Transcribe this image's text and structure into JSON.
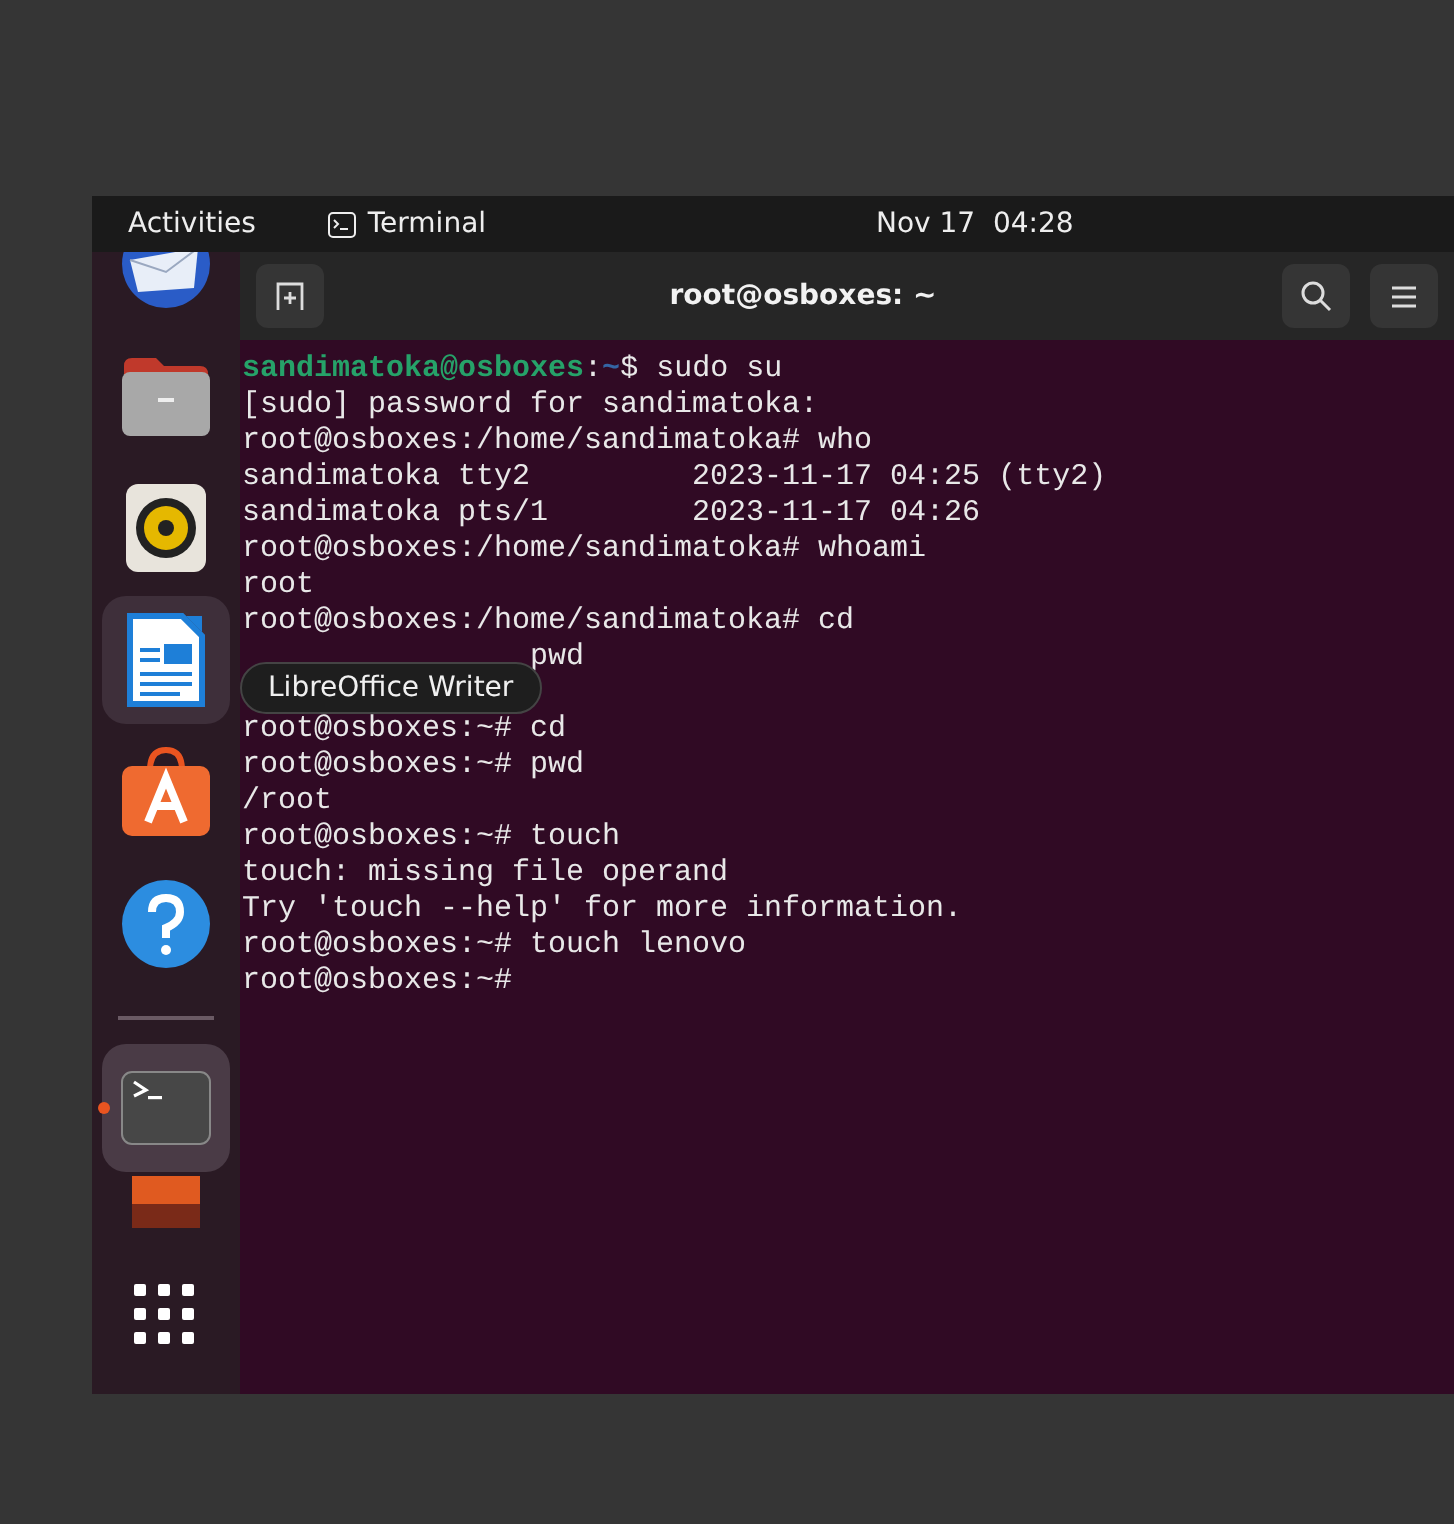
{
  "top_bar": {
    "activities": "Activities",
    "app_menu": "Terminal",
    "clock": "Nov 17  04:28"
  },
  "dock": {
    "items": [
      {
        "kind": "mail",
        "hovered": false,
        "running": false
      },
      {
        "kind": "files",
        "hovered": false,
        "running": false
      },
      {
        "kind": "music",
        "hovered": false,
        "running": false
      },
      {
        "kind": "writer",
        "hovered": true,
        "running": false
      },
      {
        "kind": "store",
        "hovered": false,
        "running": false
      },
      {
        "kind": "help",
        "hovered": false,
        "running": false
      },
      {
        "kind": "terminal",
        "hovered": false,
        "running": true
      },
      {
        "kind": "image",
        "hovered": false,
        "running": false
      },
      {
        "kind": "apps",
        "hovered": false,
        "running": false
      }
    ],
    "tooltip": "LibreOffice Writer"
  },
  "terminal": {
    "title": "root@osboxes: ~",
    "lines": [
      {
        "kind": "text",
        "segments": [
          {
            "kind": "user",
            "text": "sandimatoka@osboxes"
          },
          {
            "kind": "plain",
            "text": ":"
          },
          {
            "kind": "path",
            "text": "~"
          },
          {
            "kind": "plain",
            "text": "$ sudo su"
          }
        ]
      },
      {
        "kind": "text",
        "segments": [
          {
            "kind": "plain",
            "text": "[sudo] password for sandimatoka:"
          }
        ]
      },
      {
        "kind": "text",
        "segments": [
          {
            "kind": "plain",
            "text": "root@osboxes:/home/sandimatoka# who"
          }
        ]
      },
      {
        "kind": "text",
        "segments": [
          {
            "kind": "plain",
            "text": "sandimatoka tty2         2023-11-17 04:25 (tty2)"
          }
        ]
      },
      {
        "kind": "text",
        "segments": [
          {
            "kind": "plain",
            "text": "sandimatoka pts/1        2023-11-17 04:26"
          }
        ]
      },
      {
        "kind": "text",
        "segments": [
          {
            "kind": "plain",
            "text": "root@osboxes:/home/sandimatoka# whoami"
          }
        ]
      },
      {
        "kind": "text",
        "segments": [
          {
            "kind": "plain",
            "text": "root"
          }
        ]
      },
      {
        "kind": "text",
        "segments": [
          {
            "kind": "plain",
            "text": "root@osboxes:/home/sandimatoka# cd"
          }
        ]
      },
      {
        "kind": "tail",
        "segments": [
          {
            "kind": "plain",
            "text": "pwd"
          }
        ]
      },
      {
        "kind": "covered"
      },
      {
        "kind": "text",
        "segments": [
          {
            "kind": "plain",
            "text": "root@osboxes:~# cd"
          }
        ]
      },
      {
        "kind": "text",
        "segments": [
          {
            "kind": "plain",
            "text": "root@osboxes:~# pwd"
          }
        ]
      },
      {
        "kind": "text",
        "segments": [
          {
            "kind": "plain",
            "text": "/root"
          }
        ]
      },
      {
        "kind": "text",
        "segments": [
          {
            "kind": "plain",
            "text": "root@osboxes:~# touch"
          }
        ]
      },
      {
        "kind": "text",
        "segments": [
          {
            "kind": "plain",
            "text": "touch: missing file operand"
          }
        ]
      },
      {
        "kind": "text",
        "segments": [
          {
            "kind": "plain",
            "text": "Try 'touch --help' for more information."
          }
        ]
      },
      {
        "kind": "text",
        "segments": [
          {
            "kind": "plain",
            "text": "root@osboxes:~# touch lenovo"
          }
        ]
      },
      {
        "kind": "text",
        "segments": [
          {
            "kind": "plain",
            "text": "root@osboxes:~#"
          }
        ]
      }
    ]
  }
}
